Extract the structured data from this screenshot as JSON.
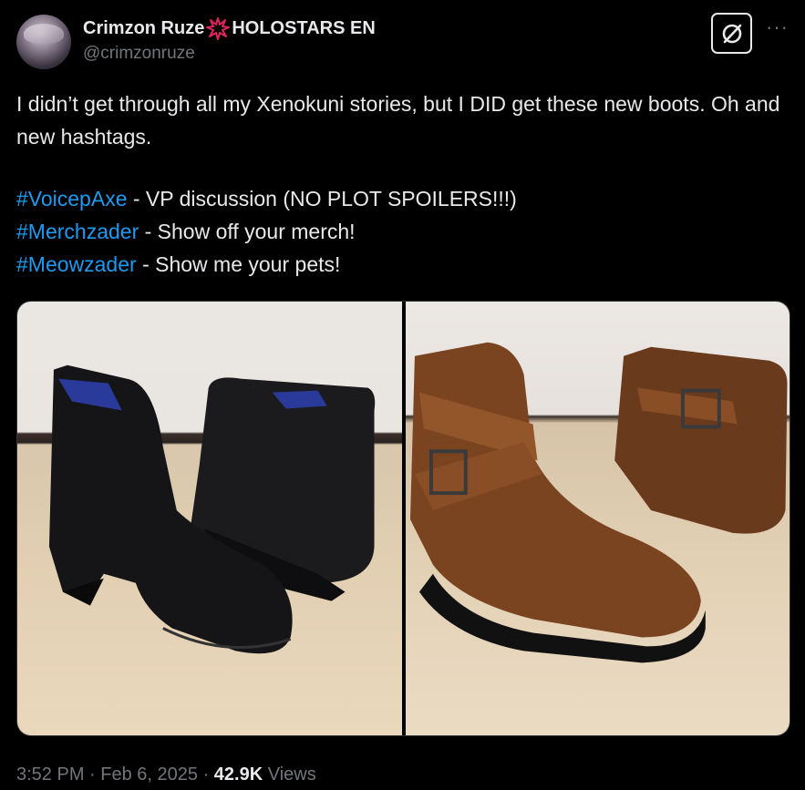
{
  "author": {
    "display_name": "Crimzon Ruze",
    "affiliation": "HOLOSTARS EN",
    "handle": "@crimzonruze"
  },
  "tweet": {
    "line1": "I didn’t get through all my Xenokuni stories, but I DID get these new boots.  Oh and new hashtags.",
    "hashtags": [
      {
        "tag": "#VoicepAxe",
        "desc": " - VP discussion (NO PLOT SPOILERS!!!)"
      },
      {
        "tag": "#Merchzader",
        "desc": " - Show off your merch!"
      },
      {
        "tag": "#Meowzader",
        "desc": " - Show me your pets!"
      }
    ]
  },
  "media": {
    "photos": [
      "black-lace-up-boots",
      "brown-buckle-boots"
    ]
  },
  "meta": {
    "time": "3:52 PM",
    "date": "Feb 6, 2025",
    "separator": " · ",
    "views_count": "42.9K",
    "views_label": "Views"
  },
  "icons": {
    "grok": "grok-icon",
    "more": "more-icon",
    "burst": "anger-burst-icon"
  }
}
